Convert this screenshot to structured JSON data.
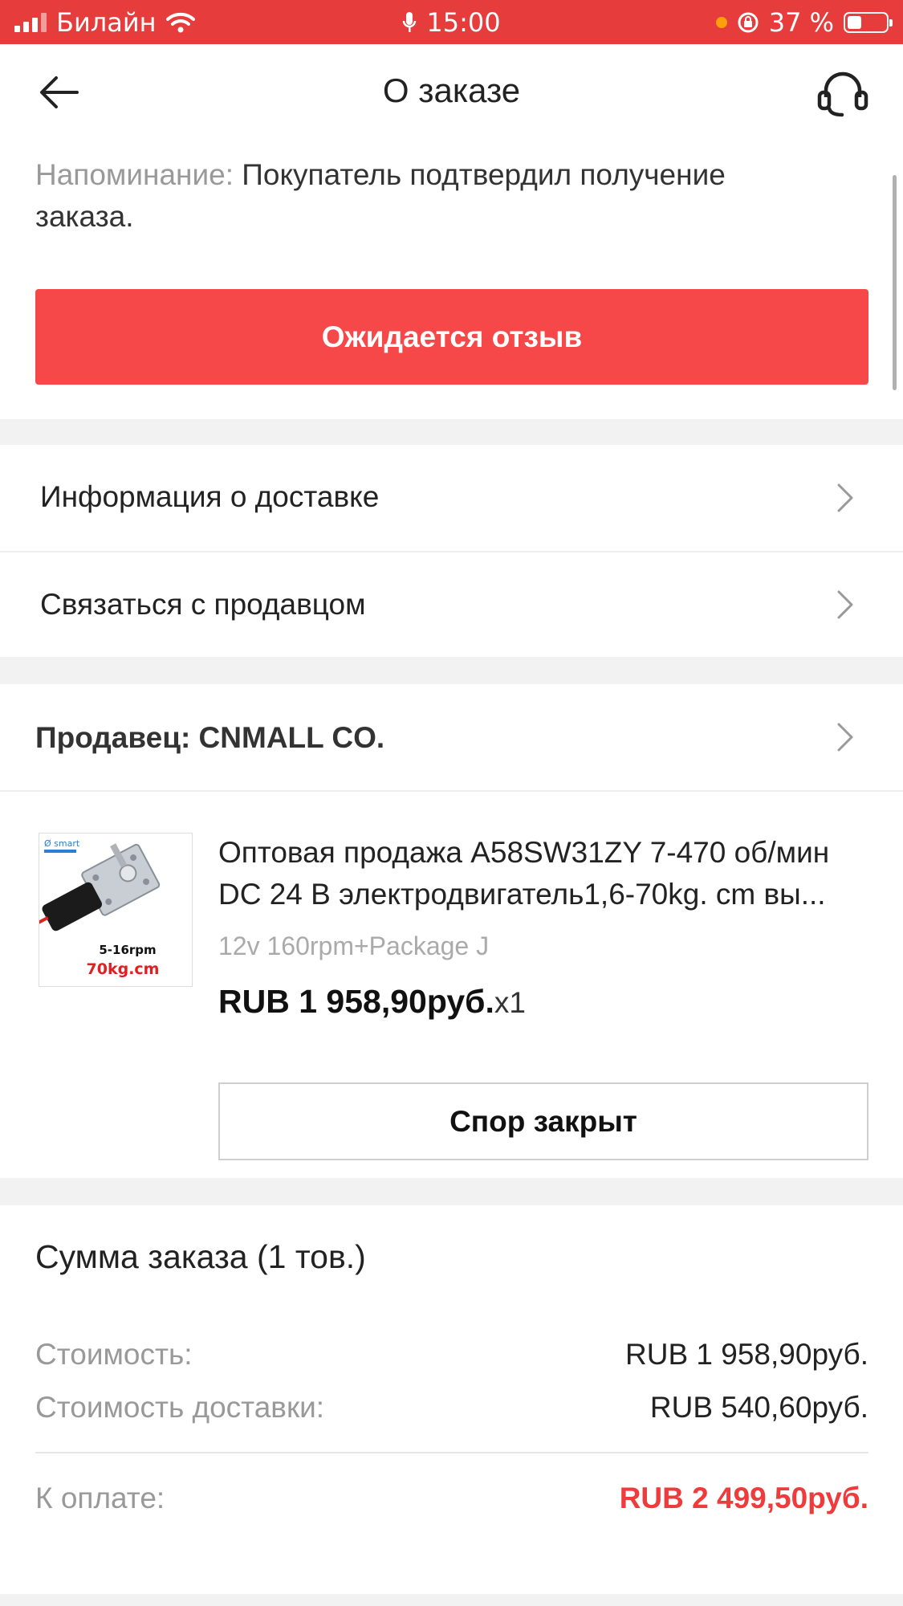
{
  "status_bar": {
    "carrier": "Билайн",
    "time": "15:00",
    "battery_percent": "37 %",
    "battery_level": 0.37
  },
  "nav": {
    "title": "О заказе",
    "back_icon": "arrow-left-icon",
    "support_icon": "headset-icon"
  },
  "reminder": {
    "label": "Напоминание:",
    "text": " Покупатель подтвердил получение заказа."
  },
  "review_button": {
    "label": "Ожидается отзыв"
  },
  "links": [
    {
      "label": "Информация о доставке"
    },
    {
      "label": "Связаться с продавцом"
    }
  ],
  "seller": {
    "label": "Продавец: CNMALL CO."
  },
  "product": {
    "title": "Оптовая продажа A58SW31ZY 7-470 об/мин DC 24 В электродвигатель1,6-70kg. cm вы...",
    "variant": "12v 160rpm+Package J",
    "price": "RUB 1 958,90руб.",
    "quantity": "x1",
    "image_text": {
      "brand": "Ø smart",
      "rpm": "5-16rpm",
      "torque": "70kg.cm"
    }
  },
  "dispute_button": {
    "label": "Спор закрыт"
  },
  "summary": {
    "title": "Сумма заказа (1 тов.)",
    "cost_label": "Стоимость:",
    "cost_value": "RUB 1 958,90руб.",
    "shipping_label": "Стоимость доставки:",
    "shipping_value": "RUB 540,60руб.",
    "total_label": "К оплате:",
    "total_value": "RUB 2 499,50руб."
  },
  "colors": {
    "status_bar": "#e63c3c",
    "primary_button": "#f64848",
    "total_price": "#ee3b3b"
  }
}
